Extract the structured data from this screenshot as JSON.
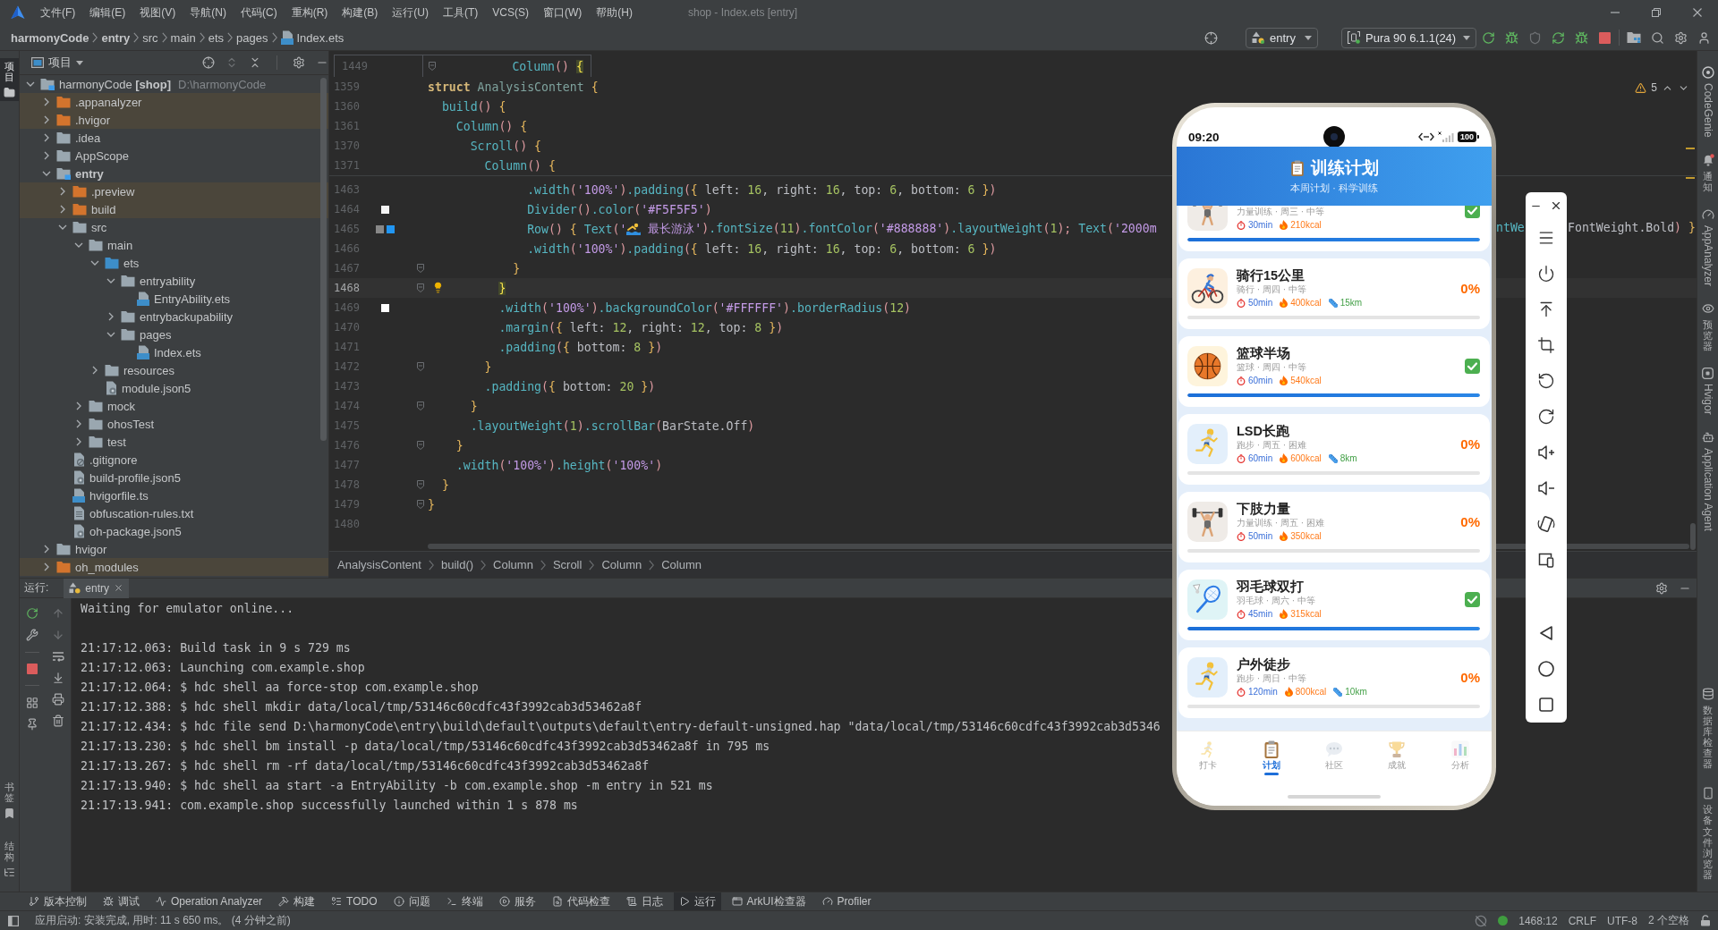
{
  "window": {
    "title": "shop - Index.ets [entry]",
    "menu": [
      "文件(F)",
      "编辑(E)",
      "视图(V)",
      "导航(N)",
      "代码(C)",
      "重构(R)",
      "构建(B)",
      "运行(U)",
      "工具(T)",
      "VCS(S)",
      "窗口(W)",
      "帮助(H)"
    ]
  },
  "breadcrumb": [
    {
      "label": "harmonyCode",
      "kind": "project"
    },
    {
      "label": "entry",
      "kind": "module"
    },
    {
      "label": "src",
      "kind": "folder"
    },
    {
      "label": "main",
      "kind": "folder"
    },
    {
      "label": "ets",
      "kind": "folder"
    },
    {
      "label": "pages",
      "kind": "folder"
    },
    {
      "label": "Index.ets",
      "kind": "ets-file"
    }
  ],
  "toolbar": {
    "run_config": "entry",
    "device": "Pura 90 6.1.1(24)"
  },
  "left_stripe": {
    "top": [
      {
        "label": "项目",
        "kind": "project",
        "selected": true
      }
    ],
    "bottom": [
      {
        "label": "书签",
        "kind": "bookmarks",
        "selected": false
      },
      {
        "label": "结构",
        "kind": "structure",
        "selected": false
      }
    ]
  },
  "project_panel": {
    "title": "项目",
    "tree": [
      {
        "name": "harmonyCode **[shop]**",
        "path": "D:\\harmonyCode",
        "kind": "project",
        "expanded": true,
        "children": [
          {
            "name": ".appanalyzer",
            "kind": "excluded",
            "expanded": false
          },
          {
            "name": ".hvigor",
            "kind": "excluded",
            "expanded": false
          },
          {
            "name": ".idea",
            "kind": "folder",
            "expanded": false
          },
          {
            "name": "AppScope",
            "kind": "folder",
            "expanded": false
          },
          {
            "name": "entry",
            "kind": "module",
            "expanded": true,
            "children": [
              {
                "name": ".preview",
                "kind": "excluded",
                "expanded": false
              },
              {
                "name": "build",
                "kind": "excluded",
                "expanded": false
              },
              {
                "name": "src",
                "kind": "folder",
                "expanded": true,
                "children": [
                  {
                    "name": "main",
                    "kind": "folder",
                    "expanded": true,
                    "children": [
                      {
                        "name": "ets",
                        "kind": "source",
                        "expanded": true,
                        "children": [
                          {
                            "name": "entryability",
                            "kind": "folder",
                            "expanded": true,
                            "children": [
                              {
                                "name": "EntryAbility.ets",
                                "kind": "ets"
                              }
                            ]
                          },
                          {
                            "name": "entrybackupability",
                            "kind": "folder",
                            "expanded": false
                          },
                          {
                            "name": "pages",
                            "kind": "folder",
                            "expanded": true,
                            "children": [
                              {
                                "name": "Index.ets",
                                "kind": "ets"
                              }
                            ]
                          }
                        ]
                      },
                      {
                        "name": "resources",
                        "kind": "folder",
                        "expanded": false
                      },
                      {
                        "name": "module.json5",
                        "kind": "json"
                      }
                    ]
                  },
                  {
                    "name": "mock",
                    "kind": "folder",
                    "expanded": false
                  },
                  {
                    "name": "ohosTest",
                    "kind": "folder",
                    "expanded": false
                  },
                  {
                    "name": "test",
                    "kind": "folder",
                    "expanded": false
                  }
                ]
              },
              {
                "name": ".gitignore",
                "kind": "ignore"
              },
              {
                "name": "build-profile.json5",
                "kind": "json"
              },
              {
                "name": "hvigorfile.ts",
                "kind": "ts"
              },
              {
                "name": "obfuscation-rules.txt",
                "kind": "txt"
              },
              {
                "name": "oh-package.json5",
                "kind": "json"
              }
            ]
          },
          {
            "name": "hvigor",
            "kind": "folder",
            "expanded": false
          },
          {
            "name": "oh_modules",
            "kind": "excluded",
            "expanded": false
          }
        ]
      }
    ]
  },
  "editor": {
    "hint": {
      "number": "1449",
      "fold": true,
      "tokens": [
        {
          "text": "          Column",
          "kind": "fn"
        },
        {
          "text": "() ",
          "kind": "paren"
        },
        {
          "text": "{",
          "kind": "match"
        }
      ]
    },
    "sticky_lines": [
      {
        "number": "1359",
        "tokens": [
          {
            "text": "struct",
            "kind": "kw"
          },
          {
            "text": " AnalysisContent ",
            "kind": "type"
          },
          {
            "text": "{",
            "kind": "brace"
          }
        ]
      },
      {
        "number": "1360",
        "tokens": [
          {
            "text": "  build",
            "kind": "fn"
          },
          {
            "text": "() ",
            "kind": "paren"
          },
          {
            "text": "{",
            "kind": "brace"
          }
        ]
      },
      {
        "number": "1361",
        "tokens": [
          {
            "text": "    Column",
            "kind": "fn"
          },
          {
            "text": "() ",
            "kind": "paren"
          },
          {
            "text": "{",
            "kind": "brace"
          }
        ]
      },
      {
        "number": "1370",
        "tokens": [
          {
            "text": "      Scroll",
            "kind": "fn"
          },
          {
            "text": "() ",
            "kind": "paren"
          },
          {
            "text": "{",
            "kind": "brace"
          }
        ]
      },
      {
        "number": "1371",
        "tokens": [
          {
            "text": "        Column",
            "kind": "fn"
          },
          {
            "text": "() ",
            "kind": "paren"
          },
          {
            "text": "{",
            "kind": "brace"
          }
        ]
      }
    ],
    "lines": [
      {
        "number": "1463",
        "fold": false,
        "current": false,
        "tokens": [
          {
            "text": "              .width",
            "kind": "fn"
          },
          {
            "text": "(",
            "kind": "paren"
          },
          {
            "text": "'100%'",
            "kind": "str"
          },
          {
            "text": ")",
            "kind": "paren"
          },
          {
            "text": ".padding",
            "kind": "fn"
          },
          {
            "text": "(",
            "kind": "paren"
          },
          {
            "text": "{",
            "kind": "brace"
          },
          {
            "text": " left: ",
            "kind": "plain"
          },
          {
            "text": "16",
            "kind": "num"
          },
          {
            "text": ", right: ",
            "kind": "plain"
          },
          {
            "text": "16",
            "kind": "num"
          },
          {
            "text": ", top: ",
            "kind": "plain"
          },
          {
            "text": "6",
            "kind": "num"
          },
          {
            "text": ", bottom: ",
            "kind": "plain"
          },
          {
            "text": "6",
            "kind": "num"
          },
          {
            "text": " }",
            "kind": "brace"
          },
          {
            "text": ")",
            "kind": "paren"
          }
        ]
      },
      {
        "number": "1464",
        "fold": false,
        "current": false,
        "swatches": [
          {
            "color": "#f5f5f5"
          }
        ],
        "tokens": [
          {
            "text": "              Divider",
            "kind": "fn"
          },
          {
            "text": "()",
            "kind": "paren"
          },
          {
            "text": ".color",
            "kind": "fn"
          },
          {
            "text": "(",
            "kind": "paren"
          },
          {
            "text": "'#F5F5F5'",
            "kind": "str"
          },
          {
            "text": ")",
            "kind": "paren"
          }
        ]
      },
      {
        "number": "1465",
        "fold": false,
        "current": false,
        "swatches": [
          {
            "color": "#888888"
          },
          {
            "color": "#2196f3"
          }
        ],
        "tokens": [
          {
            "text": "              Row",
            "kind": "fn"
          },
          {
            "text": "() ",
            "kind": "paren"
          },
          {
            "text": "{",
            "kind": "brace"
          },
          {
            "text": " Text",
            "kind": "fn"
          },
          {
            "text": "(",
            "kind": "paren"
          },
          {
            "text": "'",
            "kind": "str"
          },
          {
            "kind": "emoji"
          },
          {
            "text": " 最长游泳'",
            "kind": "str"
          },
          {
            "text": ")",
            "kind": "paren"
          },
          {
            "text": ".fontSize",
            "kind": "fn"
          },
          {
            "text": "(",
            "kind": "paren"
          },
          {
            "text": "11",
            "kind": "num"
          },
          {
            "text": ")",
            "kind": "paren"
          },
          {
            "text": ".fontColor",
            "kind": "fn"
          },
          {
            "text": "(",
            "kind": "paren"
          },
          {
            "text": "'#888888'",
            "kind": "str"
          },
          {
            "text": ")",
            "kind": "paren"
          },
          {
            "text": ".layoutWeight",
            "kind": "fn"
          },
          {
            "text": "(",
            "kind": "paren"
          },
          {
            "text": "1",
            "kind": "num"
          },
          {
            "text": ");",
            "kind": "paren"
          },
          {
            "text": " Text",
            "kind": "fn"
          },
          {
            "text": "(",
            "kind": "paren"
          },
          {
            "text": "'2000m",
            "kind": "str"
          }
        ],
        "beyond": [
          {
            "tokens": [
              {
                "text": "ntWe",
                "kind": "fn"
              }
            ]
          },
          {
            "tokens": [
              {
                "text": "FontWeight.Bold",
                "kind": "plain"
              },
              {
                "text": ")",
                "kind": "paren"
              },
              {
                "text": " }",
                "kind": "brace"
              }
            ]
          }
        ]
      },
      {
        "number": "1466",
        "fold": false,
        "current": false,
        "tokens": [
          {
            "text": "              .width",
            "kind": "fn"
          },
          {
            "text": "(",
            "kind": "paren"
          },
          {
            "text": "'100%'",
            "kind": "str"
          },
          {
            "text": ")",
            "kind": "paren"
          },
          {
            "text": ".padding",
            "kind": "fn"
          },
          {
            "text": "(",
            "kind": "paren"
          },
          {
            "text": "{",
            "kind": "brace"
          },
          {
            "text": " left: ",
            "kind": "plain"
          },
          {
            "text": "16",
            "kind": "num"
          },
          {
            "text": ", right: ",
            "kind": "plain"
          },
          {
            "text": "16",
            "kind": "num"
          },
          {
            "text": ", top: ",
            "kind": "plain"
          },
          {
            "text": "6",
            "kind": "num"
          },
          {
            "text": ", bottom: ",
            "kind": "plain"
          },
          {
            "text": "6",
            "kind": "num"
          },
          {
            "text": " }",
            "kind": "brace"
          },
          {
            "text": ")",
            "kind": "paren"
          }
        ]
      },
      {
        "number": "1467",
        "fold": true,
        "current": false,
        "tokens": [
          {
            "text": "            }",
            "kind": "brace"
          }
        ]
      },
      {
        "number": "1468",
        "fold": true,
        "current": true,
        "tokens": [
          {
            "text": "          }",
            "kind": "match"
          }
        ]
      },
      {
        "number": "1469",
        "fold": false,
        "current": false,
        "swatches": [
          {
            "color": "#ffffff"
          }
        ],
        "tokens": [
          {
            "text": "          .width",
            "kind": "fn"
          },
          {
            "text": "(",
            "kind": "paren"
          },
          {
            "text": "'100%'",
            "kind": "str"
          },
          {
            "text": ")",
            "kind": "paren"
          },
          {
            "text": ".backgroundColor",
            "kind": "fn"
          },
          {
            "text": "(",
            "kind": "paren"
          },
          {
            "text": "'#FFFFFF'",
            "kind": "str"
          },
          {
            "text": ")",
            "kind": "paren"
          },
          {
            "text": ".borderRadius",
            "kind": "fn"
          },
          {
            "text": "(",
            "kind": "paren"
          },
          {
            "text": "12",
            "kind": "num"
          },
          {
            "text": ")",
            "kind": "paren"
          }
        ]
      },
      {
        "number": "1470",
        "fold": false,
        "current": false,
        "tokens": [
          {
            "text": "          .margin",
            "kind": "fn"
          },
          {
            "text": "(",
            "kind": "paren"
          },
          {
            "text": "{",
            "kind": "brace"
          },
          {
            "text": " left: ",
            "kind": "plain"
          },
          {
            "text": "12",
            "kind": "num"
          },
          {
            "text": ", right: ",
            "kind": "plain"
          },
          {
            "text": "12",
            "kind": "num"
          },
          {
            "text": ", top: ",
            "kind": "plain"
          },
          {
            "text": "8",
            "kind": "num"
          },
          {
            "text": " }",
            "kind": "brace"
          },
          {
            "text": ")",
            "kind": "paren"
          }
        ]
      },
      {
        "number": "1471",
        "fold": false,
        "current": false,
        "tokens": [
          {
            "text": "          .padding",
            "kind": "fn"
          },
          {
            "text": "(",
            "kind": "paren"
          },
          {
            "text": "{",
            "kind": "brace"
          },
          {
            "text": " bottom: ",
            "kind": "plain"
          },
          {
            "text": "8",
            "kind": "num"
          },
          {
            "text": " }",
            "kind": "brace"
          },
          {
            "text": ")",
            "kind": "paren"
          }
        ]
      },
      {
        "number": "1472",
        "fold": true,
        "current": false,
        "tokens": [
          {
            "text": "        }",
            "kind": "brace"
          }
        ]
      },
      {
        "number": "1473",
        "fold": false,
        "current": false,
        "tokens": [
          {
            "text": "        .padding",
            "kind": "fn"
          },
          {
            "text": "(",
            "kind": "paren"
          },
          {
            "text": "{",
            "kind": "brace"
          },
          {
            "text": " bottom: ",
            "kind": "plain"
          },
          {
            "text": "20",
            "kind": "num"
          },
          {
            "text": " }",
            "kind": "brace"
          },
          {
            "text": ")",
            "kind": "paren"
          }
        ]
      },
      {
        "number": "1474",
        "fold": true,
        "current": false,
        "tokens": [
          {
            "text": "      }",
            "kind": "brace"
          }
        ]
      },
      {
        "number": "1475",
        "fold": false,
        "current": false,
        "tokens": [
          {
            "text": "      .layoutWeight",
            "kind": "fn"
          },
          {
            "text": "(",
            "kind": "paren"
          },
          {
            "text": "1",
            "kind": "num"
          },
          {
            "text": ")",
            "kind": "paren"
          },
          {
            "text": ".scrollBar",
            "kind": "fn"
          },
          {
            "text": "(",
            "kind": "paren"
          },
          {
            "text": "BarState.Off",
            "kind": "plain"
          },
          {
            "text": ")",
            "kind": "paren"
          }
        ]
      },
      {
        "number": "1476",
        "fold": true,
        "current": false,
        "tokens": [
          {
            "text": "    }",
            "kind": "brace"
          }
        ]
      },
      {
        "number": "1477",
        "fold": false,
        "current": false,
        "tokens": [
          {
            "text": "    .width",
            "kind": "fn"
          },
          {
            "text": "(",
            "kind": "paren"
          },
          {
            "text": "'100%'",
            "kind": "str"
          },
          {
            "text": ")",
            "kind": "paren"
          },
          {
            "text": ".height",
            "kind": "fn"
          },
          {
            "text": "(",
            "kind": "paren"
          },
          {
            "text": "'100%'",
            "kind": "str"
          },
          {
            "text": ")",
            "kind": "paren"
          }
        ]
      },
      {
        "number": "1478",
        "fold": true,
        "current": false,
        "tokens": [
          {
            "text": "  }",
            "kind": "brace"
          }
        ]
      },
      {
        "number": "1479",
        "fold": true,
        "current": false,
        "tokens": [
          {
            "text": "}",
            "kind": "brace"
          }
        ]
      },
      {
        "number": "1480",
        "fold": false,
        "current": false
      }
    ],
    "warnings": "5",
    "breadcrumb": [
      "AnalysisContent",
      "build()",
      "Column",
      "Scroll",
      "Column",
      "Column"
    ]
  },
  "run_panel": {
    "label": "运行:",
    "tabs": [
      {
        "label": "entry",
        "selected": true
      }
    ],
    "log_blocks": [
      {
        "lines": [
          "Waiting for emulator online..."
        ]
      },
      {
        "lines": [
          "21:17:12.063: Build task in 9 s 729 ms",
          "21:17:12.063: Launching com.example.shop",
          "21:17:12.064: $ hdc shell aa force-stop com.example.shop",
          "21:17:12.388: $ hdc shell mkdir data/local/tmp/53146c60cdfc43f3992cab3d53462a8f",
          "21:17:12.434: $ hdc file send D:\\harmonyCode\\entry\\build\\default\\outputs\\default\\entry-default-unsigned.hap \"data/local/tmp/53146c60cdfc43f3992cab3d5346",
          "21:17:13.230: $ hdc shell bm install -p data/local/tmp/53146c60cdfc43f3992cab3d53462a8f in 795 ms",
          "21:17:13.267: $ hdc shell rm -rf data/local/tmp/53146c60cdfc43f3992cab3d53462a8f",
          "21:17:13.940: $ hdc shell aa start -a EntryAbility -b com.example.shop -m entry in 521 ms",
          "21:17:13.941: com.example.shop successfully launched within 1 s 878 ms"
        ]
      }
    ]
  },
  "right_stripe": {
    "top": [
      {
        "label": "CodeGenie",
        "kind": "genie"
      },
      {
        "label": "通知",
        "kind": "bell"
      },
      {
        "label": "AppAnalyzer",
        "kind": "analyzer"
      },
      {
        "label": "预览器",
        "kind": "eye"
      },
      {
        "label": "Hvigor",
        "kind": "hvigor"
      },
      {
        "label": "Application Agent",
        "kind": "agent"
      }
    ],
    "bottom": [
      {
        "label": "数据库检查器",
        "kind": "database"
      },
      {
        "label": "设备文件浏览器",
        "kind": "device"
      }
    ]
  },
  "tool_windows": [
    {
      "label": "版本控制",
      "kind": "vcs",
      "selected": false
    },
    {
      "label": "调试",
      "kind": "debug",
      "selected": false
    },
    {
      "label": "Operation Analyzer",
      "kind": "analyzer",
      "selected": false
    },
    {
      "label": "构建",
      "kind": "build",
      "selected": false
    },
    {
      "label": "TODO",
      "kind": "todo",
      "selected": false
    },
    {
      "label": "问题",
      "kind": "problems",
      "selected": false
    },
    {
      "label": "终端",
      "kind": "terminal",
      "selected": false
    },
    {
      "label": "服务",
      "kind": "services",
      "selected": false
    },
    {
      "label": "代码检查",
      "kind": "inspect",
      "selected": false
    },
    {
      "label": "日志",
      "kind": "log",
      "selected": false
    },
    {
      "label": "运行",
      "kind": "run",
      "selected": true
    },
    {
      "label": "ArkUI检查器",
      "kind": "arkui",
      "selected": false
    },
    {
      "label": "Profiler",
      "kind": "profiler",
      "selected": false
    }
  ],
  "status_bar": {
    "message": "应用启动: 安装完成, 用时: 11 s 650 ms。 (4 分钟之前)",
    "position": "1468:12",
    "line_ending": "CRLF",
    "encoding": "UTF-8",
    "indent": "2 个空格"
  },
  "emulator": {
    "status_bar": {
      "time": "09:20",
      "battery": "100"
    },
    "header": {
      "title": "训练计划",
      "subtitle": "本周计划 · 科学训练"
    },
    "plans": [
      {
        "kind": "strength",
        "meta": "力量训练 · 周三 · 中等",
        "duration": "30min",
        "calories": "210kcal",
        "completed": true,
        "level": 1
      },
      {
        "kind": "cycling",
        "title": "骑行15公里",
        "meta": "骑行 · 周四 · 中等",
        "duration": "50min",
        "calories": "400kcal",
        "distance": "15km",
        "completed": false,
        "percent": "0%",
        "level": 0
      },
      {
        "kind": "basketball",
        "title": "篮球半场",
        "meta": "篮球 · 周四 · 中等",
        "duration": "60min",
        "calories": "540kcal",
        "completed": true,
        "level": 1
      },
      {
        "kind": "running",
        "title": "LSD长跑",
        "meta": "跑步 · 周五 · 困难",
        "duration": "60min",
        "calories": "600kcal",
        "distance": "8km",
        "completed": false,
        "percent": "0%",
        "level": 0
      },
      {
        "kind": "strength",
        "title": "下肢力量",
        "meta": "力量训练 · 周五 · 困难",
        "duration": "50min",
        "calories": "350kcal",
        "completed": false,
        "percent": "0%",
        "level": 0
      },
      {
        "kind": "badminton",
        "title": "羽毛球双打",
        "meta": "羽毛球 · 周六 · 中等",
        "duration": "45min",
        "calories": "315kcal",
        "completed": true,
        "level": 1
      },
      {
        "kind": "running",
        "title": "户外徒步",
        "meta": "跑步 · 周日 · 中等",
        "duration": "120min",
        "calories": "800kcal",
        "distance": "10km",
        "completed": false,
        "percent": "0%",
        "level": 0
      }
    ],
    "tabs": [
      {
        "label": "打卡",
        "kind": "runner",
        "selected": false
      },
      {
        "label": "计划",
        "kind": "clipboard",
        "selected": true
      },
      {
        "label": "社区",
        "kind": "chat",
        "selected": false
      },
      {
        "label": "成就",
        "kind": "trophy",
        "selected": false
      },
      {
        "label": "分析",
        "kind": "chart",
        "selected": false
      }
    ]
  }
}
